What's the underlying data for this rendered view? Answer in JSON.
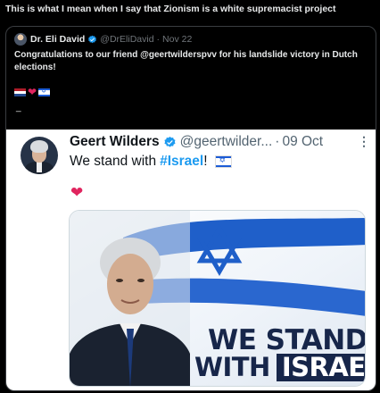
{
  "caption": "This is what I mean when I say that Zionism is a white supremacist project",
  "quoted": {
    "author_name": "Dr. Eli David",
    "handle": "@DrEliDavid",
    "separator": "·",
    "date": "Nov 22",
    "text": "Congratulations to our friend @geertwilderspvv for his landslide victory in Dutch elections!",
    "emojis": [
      "netherlands-flag",
      "red-heart",
      "israel-flag"
    ],
    "trailing": "_"
  },
  "inner": {
    "author_name": "Geert Wilders",
    "handle": "@geertwilder...",
    "separator": "·",
    "date": "09 Oct",
    "more": "⋮",
    "text_prefix": "We stand with",
    "hashtag": "#Israel",
    "text_suffix": "!",
    "heart": "❤",
    "image": {
      "banner_line1": "WE STAND",
      "banner_with": "WITH",
      "banner_israel": "ISRAEL"
    }
  },
  "colors": {
    "background": "#000000",
    "verified_blue": "#1d9bf0",
    "hashtag": "#1d9bf0",
    "banner_navy": "#17264a",
    "heart": "#e0245e",
    "muted": "#71767b"
  },
  "icons": [
    "verified-badge-icon",
    "more-options-icon",
    "israel-flag-icon",
    "heart-icon"
  ]
}
